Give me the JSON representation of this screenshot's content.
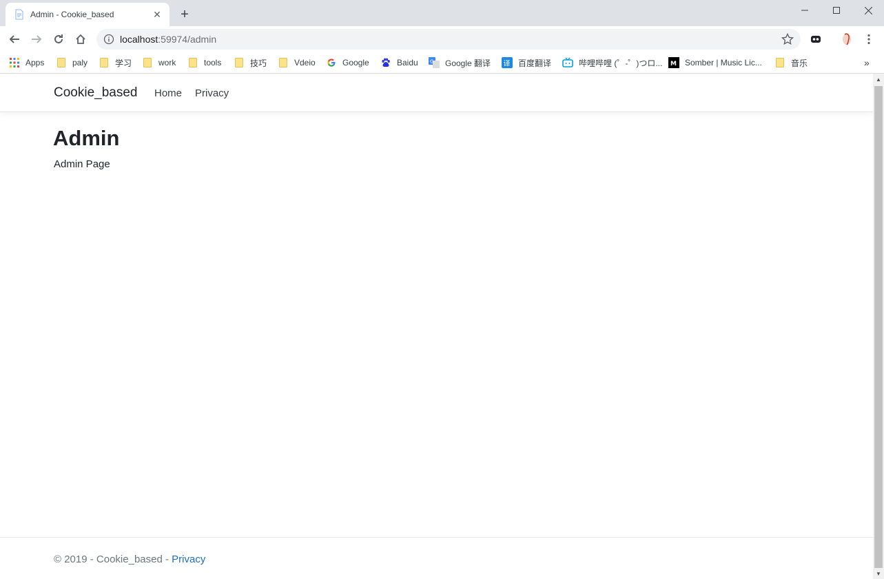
{
  "browser": {
    "tab_title": "Admin - Cookie_based",
    "url_host": "localhost",
    "url_rest": ":59974/admin",
    "bookmarks": {
      "apps": "Apps",
      "paly": "paly",
      "xuexi": "学习",
      "work": "work",
      "tools": "tools",
      "jiqiao": "技巧",
      "vdeio": "Vdeio",
      "google": "Google",
      "baidu": "Baidu",
      "google_translate": "Google 翻译",
      "baidu_translate": "百度翻译",
      "bilibili": "哔哩哔哩 (゜-゜)つロ...",
      "somber": "Somber | Music Lic...",
      "yinyue": "音乐",
      "overflow": "»"
    }
  },
  "site": {
    "brand": "Cookie_based",
    "nav": {
      "home": "Home",
      "privacy": "Privacy"
    },
    "heading": "Admin",
    "body_text": "Admin Page",
    "footer_text": "© 2019 - Cookie_based - ",
    "footer_link": "Privacy"
  },
  "colors": {
    "link": "#1b6ec2",
    "chrome_bg": "#dee1e6",
    "omnibox_bg": "#f1f3f4"
  }
}
